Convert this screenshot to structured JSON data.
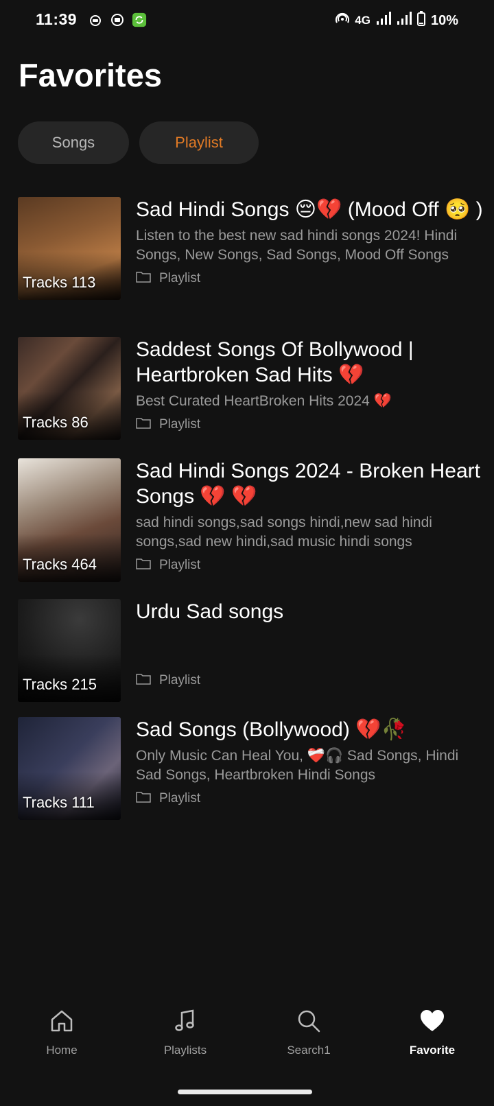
{
  "status": {
    "time": "11:39",
    "network": "4G",
    "battery": "10%"
  },
  "page": {
    "title": "Favorites"
  },
  "tabs": [
    {
      "label": "Songs",
      "active": false
    },
    {
      "label": "Playlist",
      "active": true
    }
  ],
  "playlists": [
    {
      "title": "Sad Hindi Songs 😔💔  (Mood Off 🥺 )",
      "description": "Listen to the best new sad hindi songs 2024! Hindi Songs, New Songs, Sad Songs, Mood Off Songs",
      "tracks": "Tracks 113",
      "type": "Playlist"
    },
    {
      "title": "Saddest Songs Of Bollywood | Heartbroken Sad Hits 💔",
      "description": "Best Curated HeartBroken Hits 2024 💔",
      "tracks": "Tracks 86",
      "type": "Playlist"
    },
    {
      "title": "Sad Hindi Songs 2024 - Broken Heart Songs 💔 💔",
      "description": "sad hindi songs,sad songs hindi,new sad hindi songs,sad new hindi,sad music hindi songs",
      "tracks": "Tracks 464",
      "type": "Playlist"
    },
    {
      "title": "Urdu Sad songs",
      "description": "",
      "tracks": "Tracks 215",
      "type": "Playlist"
    },
    {
      "title": "Sad Songs (Bollywood) 💔🥀",
      "description": "Only Music Can Heal You, ❤️‍🩹🎧 Sad Songs, Hindi Sad Songs, Heartbroken Hindi Songs",
      "tracks": "Tracks 111",
      "type": "Playlist"
    }
  ],
  "nav": {
    "home": "Home",
    "playlists": "Playlists",
    "search": "Search1",
    "favorite": "Favorite"
  },
  "colors": {
    "accent": "#e37b25",
    "background": "#121212"
  }
}
